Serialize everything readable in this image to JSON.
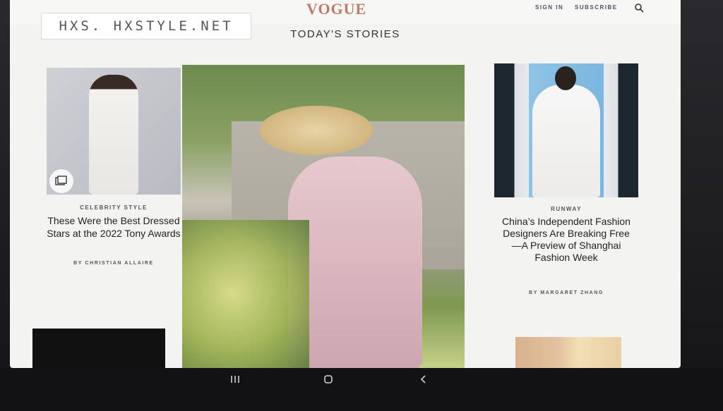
{
  "watermark": "HXS. HXSTYLE.NET",
  "header": {
    "logo": "VOGUE",
    "sign_in": "SIGN IN",
    "subscribe": "SUBSCRIBE",
    "search_icon": "search-icon"
  },
  "section_title": "TODAY'S STORIES",
  "left_story": {
    "kicker": "CELEBRITY STYLE",
    "headline": "These Were the Best Dressed Stars at the 2022 Tony Awards",
    "byline": "BY CHRISTIAN ALLAIRE",
    "badge_icon": "gallery-icon"
  },
  "right_story": {
    "kicker": "RUNWAY",
    "headline": "China’s Independent Fashion Designers Are Breaking Free—A Preview of Shanghai Fashion Week",
    "byline": "BY MARGARET ZHANG"
  },
  "android_nav": {
    "recents_icon": "recents-icon",
    "home_icon": "home-icon",
    "back_icon": "back-icon"
  },
  "colors": {
    "logo": "#c07a6a",
    "nav_text": "#4a4f6a",
    "page_bg": "#f3f3f1"
  }
}
